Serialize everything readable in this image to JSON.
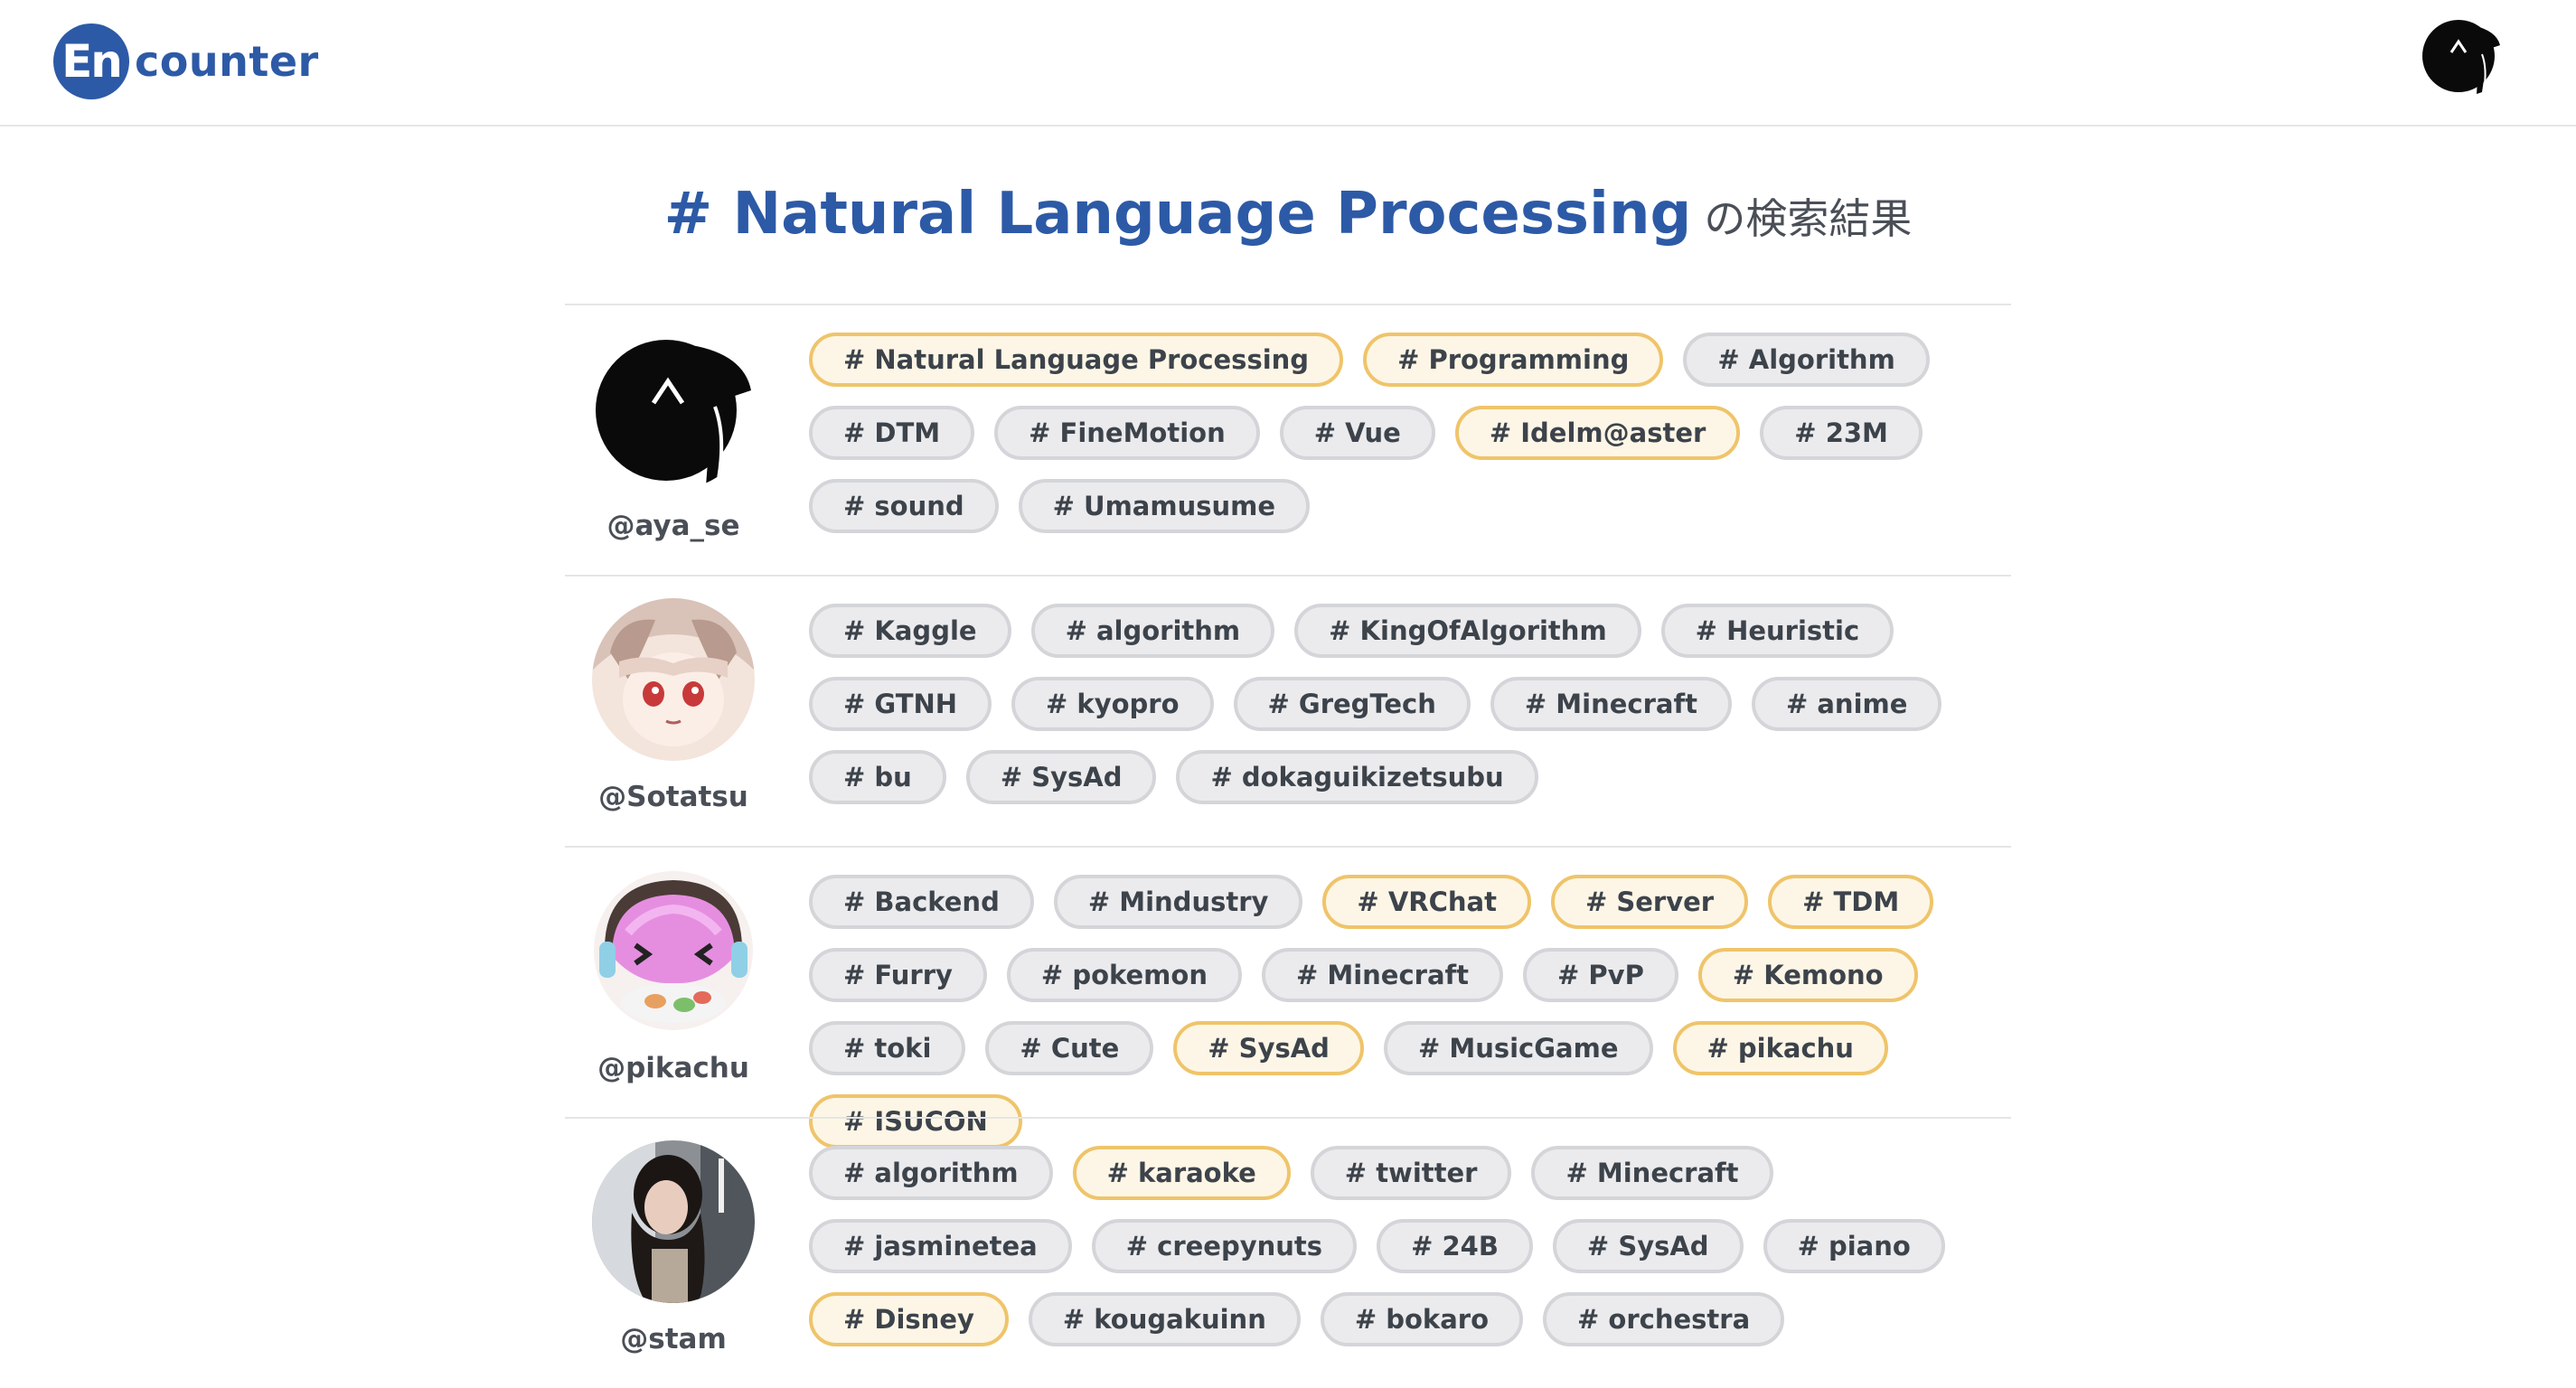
{
  "header": {
    "logo_mark": "En",
    "logo_text": "counter"
  },
  "title": {
    "tag": "# Natural Language Processing",
    "suffix": "の検索結果"
  },
  "results": [
    {
      "username": "@aya_se",
      "avatar": "aya-avatar",
      "tags": [
        {
          "label": "# Natural Language Processing",
          "highlight": true
        },
        {
          "label": "# Programming",
          "highlight": true
        },
        {
          "label": "# Algorithm",
          "highlight": false
        },
        {
          "label": "# DTM",
          "highlight": false
        },
        {
          "label": "# FineMotion",
          "highlight": false
        },
        {
          "label": "# Vue",
          "highlight": false
        },
        {
          "label": "# Idelm@aster",
          "highlight": true
        },
        {
          "label": "# 23M",
          "highlight": false
        },
        {
          "label": "# sound",
          "highlight": false
        },
        {
          "label": "# Umamusume",
          "highlight": false
        }
      ]
    },
    {
      "username": "@Sotatsu",
      "avatar": "sotatsu-avatar",
      "tags": [
        {
          "label": "# Kaggle",
          "highlight": false
        },
        {
          "label": "# algorithm",
          "highlight": false
        },
        {
          "label": "# KingOfAlgorithm",
          "highlight": false
        },
        {
          "label": "# Heuristic",
          "highlight": false
        },
        {
          "label": "# GTNH",
          "highlight": false
        },
        {
          "label": "# kyopro",
          "highlight": false
        },
        {
          "label": "# GregTech",
          "highlight": false
        },
        {
          "label": "# Minecraft",
          "highlight": false
        },
        {
          "label": "# anime",
          "highlight": false
        },
        {
          "label": "# bu",
          "highlight": false
        },
        {
          "label": "# SysAd",
          "highlight": false
        },
        {
          "label": "# dokaguikizetsubu",
          "highlight": false
        }
      ]
    },
    {
      "username": "@pikachu",
      "avatar": "pikachu-avatar",
      "tags": [
        {
          "label": "# Backend",
          "highlight": false
        },
        {
          "label": "# Mindustry",
          "highlight": false
        },
        {
          "label": "# VRChat",
          "highlight": true
        },
        {
          "label": "# Server",
          "highlight": true
        },
        {
          "label": "# TDM",
          "highlight": true
        },
        {
          "label": "# Furry",
          "highlight": false
        },
        {
          "label": "# pokemon",
          "highlight": false
        },
        {
          "label": "# Minecraft",
          "highlight": false
        },
        {
          "label": "# PvP",
          "highlight": false
        },
        {
          "label": "# Kemono",
          "highlight": true
        },
        {
          "label": "# toki",
          "highlight": false
        },
        {
          "label": "# Cute",
          "highlight": false
        },
        {
          "label": "# SysAd",
          "highlight": true
        },
        {
          "label": "# MusicGame",
          "highlight": false
        },
        {
          "label": "# pikachu",
          "highlight": true
        },
        {
          "label": "# ISUCON",
          "highlight": true
        }
      ]
    },
    {
      "username": "@stam",
      "avatar": "stam-avatar",
      "tags": [
        {
          "label": "# algorithm",
          "highlight": false
        },
        {
          "label": "# karaoke",
          "highlight": true
        },
        {
          "label": "# twitter",
          "highlight": false
        },
        {
          "label": "# Minecraft",
          "highlight": false
        },
        {
          "label": "# jasminetea",
          "highlight": false
        },
        {
          "label": "# creepynuts",
          "highlight": false
        },
        {
          "label": "# 24B",
          "highlight": false
        },
        {
          "label": "# SysAd",
          "highlight": false
        },
        {
          "label": "# piano",
          "highlight": false
        },
        {
          "label": "# Disney",
          "highlight": true
        },
        {
          "label": "# kougakuinn",
          "highlight": false
        },
        {
          "label": "# bokaro",
          "highlight": false
        },
        {
          "label": "# orchestra",
          "highlight": false
        }
      ]
    }
  ]
}
